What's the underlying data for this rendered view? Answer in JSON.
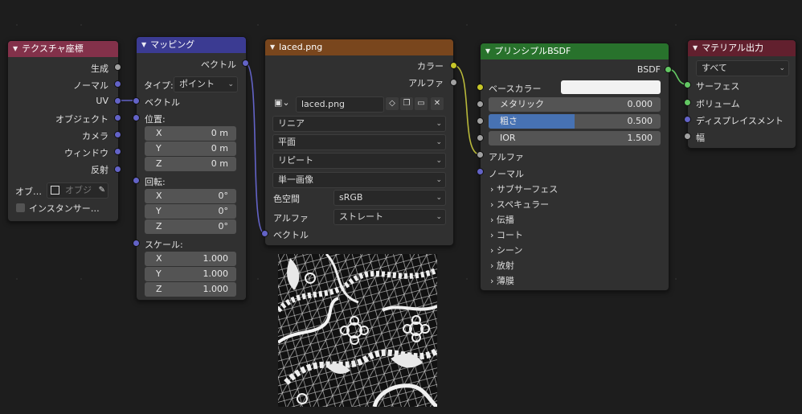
{
  "nodes": {
    "texcoord": {
      "title": "テクスチャ座標",
      "outputs": [
        "生成",
        "ノーマル",
        "UV",
        "オブジェクト",
        "カメラ",
        "ウィンドウ",
        "反射"
      ],
      "object_label": "オブ…",
      "object_placeholder": "オブジ",
      "instancer_label": "インスタンサー…"
    },
    "mapping": {
      "title": "マッピング",
      "output": "ベクトル",
      "type_label": "タイプ:",
      "type_value": "ポイント",
      "vector_input": "ベクトル",
      "location": {
        "label": "位置:",
        "x": "0 m",
        "y": "0 m",
        "z": "0 m"
      },
      "rotation": {
        "label": "回転:",
        "x": "0°",
        "y": "0°",
        "z": "0°"
      },
      "scale": {
        "label": "スケール:",
        "x": "1.000",
        "y": "1.000",
        "z": "1.000"
      },
      "axis": {
        "x": "X",
        "y": "Y",
        "z": "Z"
      }
    },
    "image": {
      "title": "laced.png",
      "out_color": "カラー",
      "out_alpha": "アルファ",
      "image_name": "laced.png",
      "interpolation": "リニア",
      "projection": "平面",
      "extension": "リピート",
      "source": "単一画像",
      "colorspace_label": "色空間",
      "colorspace_value": "sRGB",
      "alpha_label": "アルファ",
      "alpha_value": "ストレート",
      "vector_input": "ベクトル"
    },
    "bsdf": {
      "title": "プリンシプルBSDF",
      "output": "BSDF",
      "base_color": "ベースカラー",
      "metallic": {
        "label": "メタリック",
        "value": "0.000"
      },
      "roughness": {
        "label": "粗さ",
        "value": "0.500",
        "fraction": 0.5
      },
      "ior": {
        "label": "IOR",
        "value": "1.500"
      },
      "alpha": "アルファ",
      "normal": "ノーマル",
      "panels": [
        "サブサーフェス",
        "スペキュラー",
        "伝播",
        "コート",
        "シーン",
        "放射",
        "薄膜"
      ]
    },
    "output": {
      "title": "マテリアル出力",
      "target": "すべて",
      "inputs": [
        "サーフェス",
        "ボリューム",
        "ディスプレイスメント",
        "幅"
      ]
    }
  },
  "colors": {
    "header_texcoord": "#83314a",
    "header_mapping": "#3b3b92",
    "header_image": "#79461d",
    "header_bsdf": "#28722c",
    "header_output": "#62202e",
    "socket_vector": "#6363c7",
    "socket_color": "#c7c729",
    "socket_float": "#a1a1a1",
    "socket_shader": "#63c763",
    "roughness_fill": "#4772b3"
  }
}
